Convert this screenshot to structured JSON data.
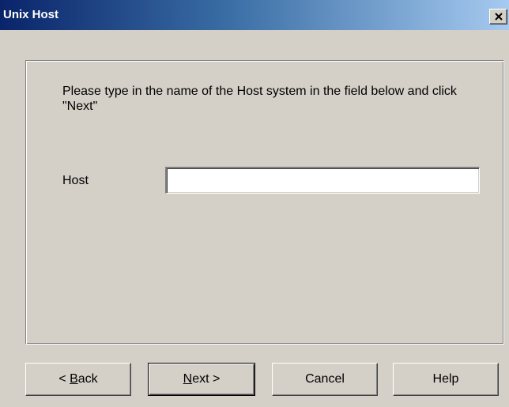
{
  "window": {
    "title": "Unix Host",
    "close_glyph": "close-icon"
  },
  "main": {
    "instructions": "Please type in the name of the Host system in the field below and click \"Next\"",
    "host_label": "Host",
    "host_value": "",
    "host_placeholder": ""
  },
  "buttons": {
    "back": {
      "prefix": "< ",
      "mnemonic": "B",
      "rest": "ack"
    },
    "next": {
      "prefix": "",
      "mnemonic": "N",
      "rest": "ext >"
    },
    "cancel": "Cancel",
    "help": "Help"
  },
  "colors": {
    "dialog_face": "#d4d0c8",
    "title_active_start": "#0a246a",
    "title_active_end": "#a6caf0",
    "title_text": "#ffffff"
  }
}
